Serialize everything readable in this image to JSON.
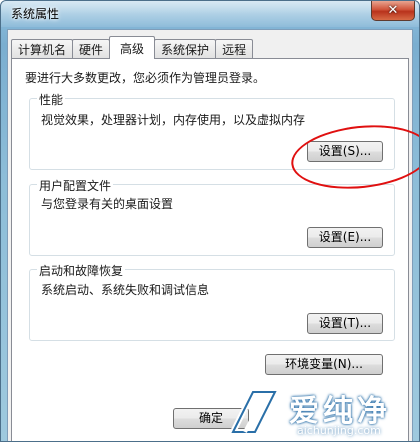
{
  "window": {
    "title": "系统属性",
    "close_glyph": "✕"
  },
  "tabs": [
    {
      "label": "计算机名"
    },
    {
      "label": "硬件"
    },
    {
      "label": "高级"
    },
    {
      "label": "系统保护"
    },
    {
      "label": "远程"
    }
  ],
  "advanced": {
    "notice": "要进行大多数更改，您必须作为管理员登录。",
    "performance": {
      "title": "性能",
      "description": "视觉效果，处理器计划，内存使用，以及虚拟内存",
      "button": "设置(S)..."
    },
    "user_profiles": {
      "title": "用户配置文件",
      "description": "与您登录有关的桌面设置",
      "button": "设置(E)..."
    },
    "startup_recovery": {
      "title": "启动和故障恢复",
      "description": "系统启动、系统失败和调试信息",
      "button": "设置(T)..."
    },
    "env_button": "环境变量(N)..."
  },
  "footer": {
    "ok_button": "确定"
  },
  "watermark": {
    "name": "爱纯净",
    "url": "aichunjing.com"
  },
  "colors": {
    "annotation_circle": "#e01010",
    "window_frame": "#88b9d9"
  }
}
